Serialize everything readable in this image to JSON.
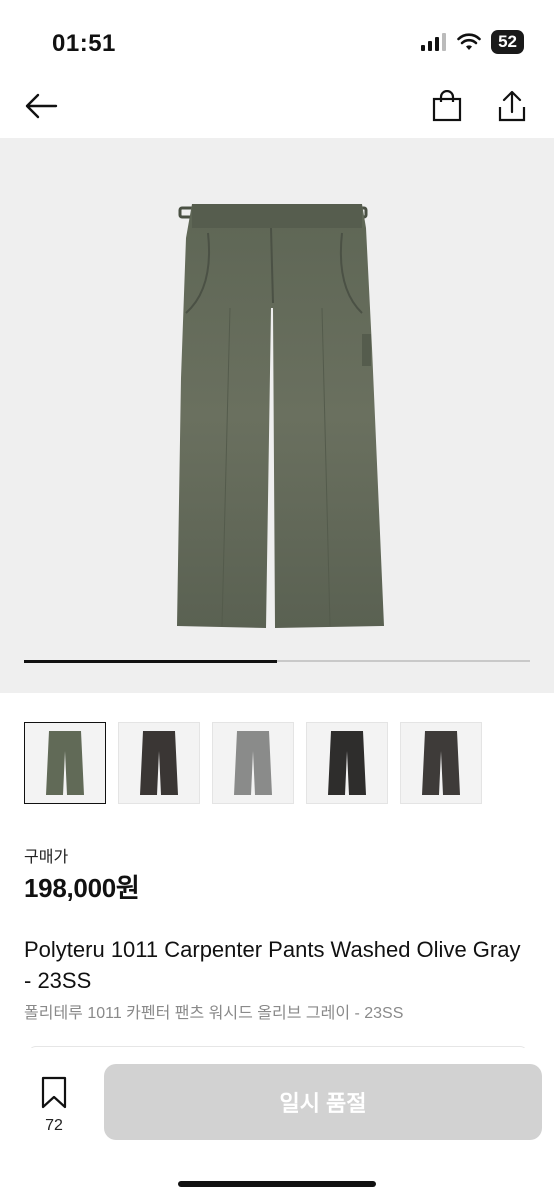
{
  "status": {
    "time": "01:51",
    "battery": "52"
  },
  "gallery": {
    "progress_fraction": 0.5,
    "thumbnail_count": 5
  },
  "product": {
    "price_label": "구매가",
    "price": "198,000원",
    "name_en": "Polyteru 1011 Carpenter Pants Washed Olive Gray - 23SS",
    "name_ko": "폴리테루 1011 카펜터 팬츠 워시드 올리브 그레이 - 23SS"
  },
  "actions": {
    "wish_count": "72",
    "soldout_label": "일시 품절"
  },
  "colors": {
    "accent": "#111111",
    "pants_colors": [
      "#616a57",
      "#3a3634",
      "#8a8b8a",
      "#2e2d2c",
      "#3e3b39"
    ]
  },
  "icons": [
    "back-arrow-icon",
    "shopping-bag-icon",
    "share-icon",
    "bookmark-icon"
  ]
}
